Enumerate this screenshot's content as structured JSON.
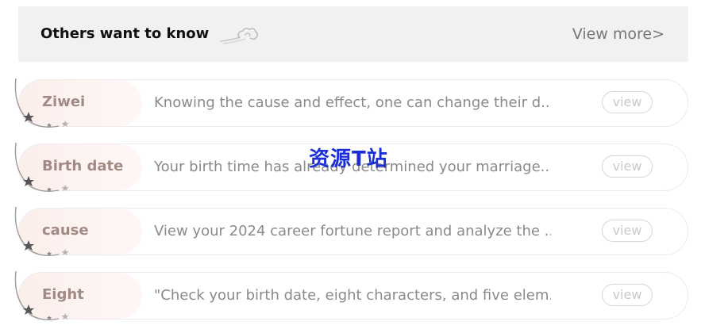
{
  "header": {
    "title": "Others want to know",
    "view_more": "View more>",
    "icon": "cloud-icon"
  },
  "items": [
    {
      "label": "Ziwei",
      "desc": "Knowing the cause and effect, one can change their d...",
      "button": "view"
    },
    {
      "label": "Birth date",
      "desc": "Your birth time has already determined your marriage...",
      "button": "view"
    },
    {
      "label": "cause",
      "desc": "View your 2024 career fortune report and analyze the ...",
      "button": "view"
    },
    {
      "label": "Eight",
      "desc": "\"Check your birth date, eight characters, and five elem...",
      "button": "view"
    }
  ],
  "watermark": "资源T站",
  "colors": {
    "header_bg": "#f1f1f1",
    "label": "#a28a84",
    "watermark": "#1c2fd6"
  }
}
